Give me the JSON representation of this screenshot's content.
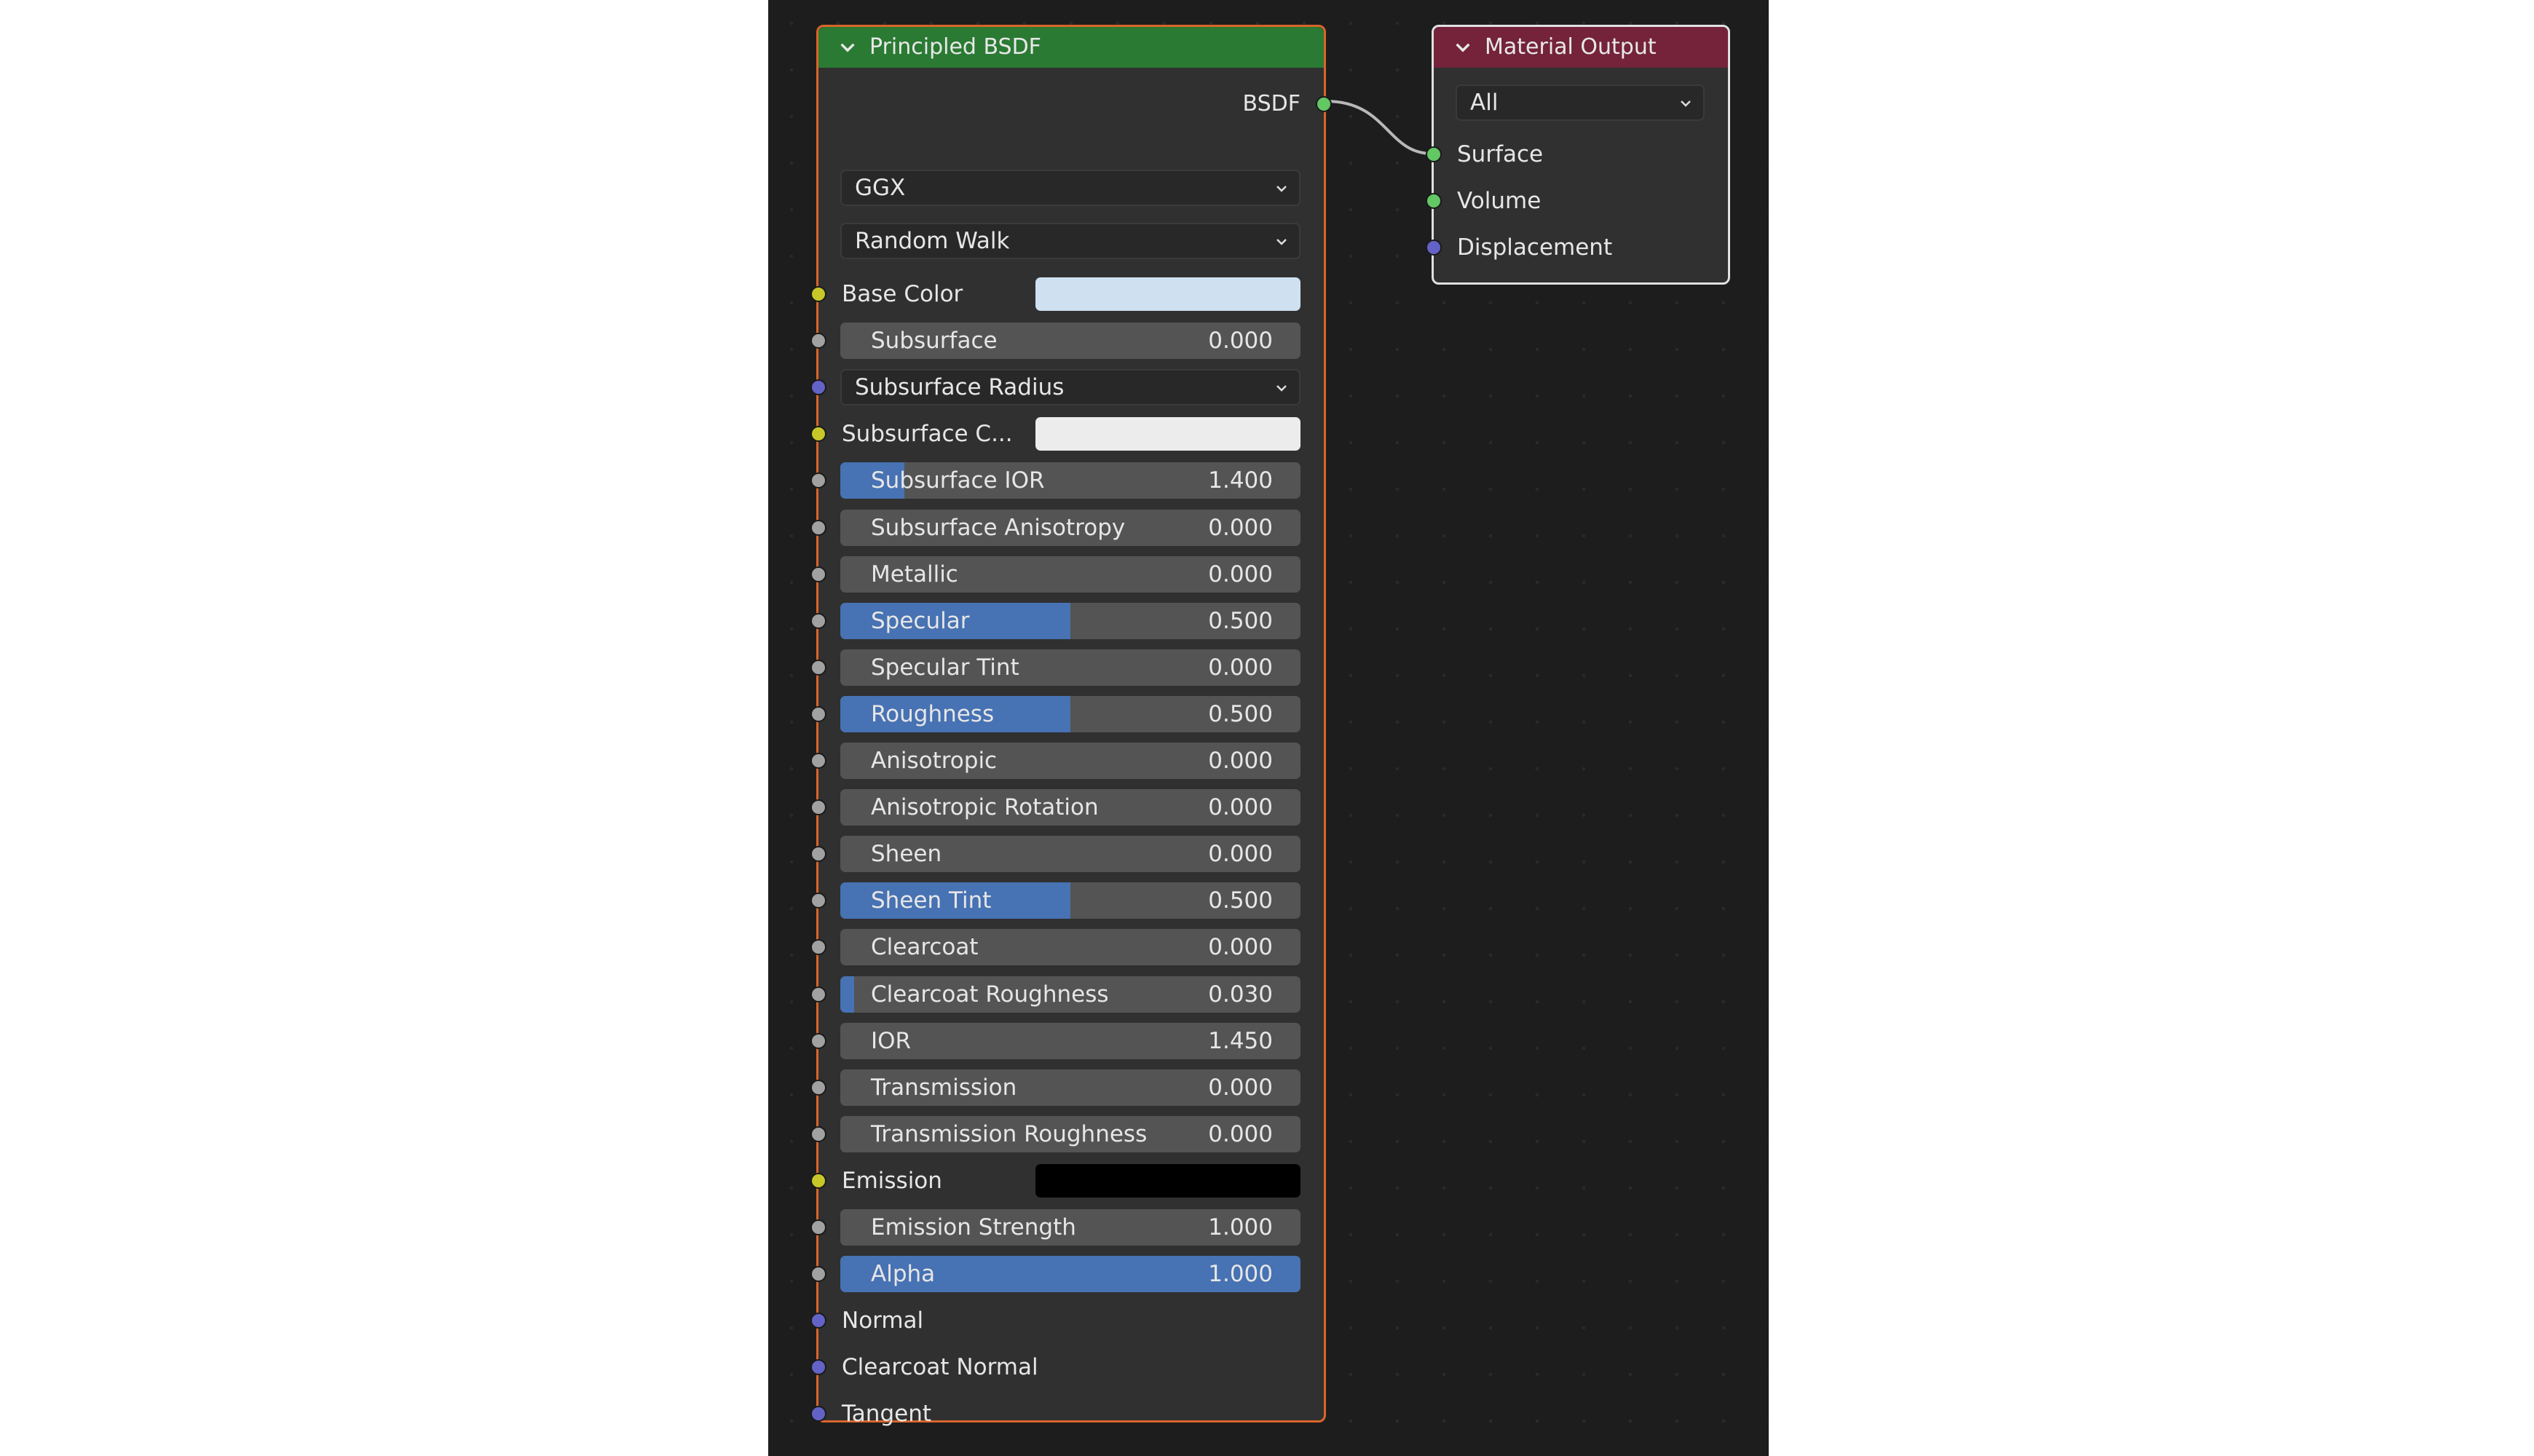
{
  "bsdf_node": {
    "title": "Principled BSDF",
    "header_color": "#2a7a33",
    "border_color": "#d9652a",
    "output_label": "BSDF",
    "distribution": "GGX",
    "subsurface_method": "Random Walk",
    "rows": [
      {
        "kind": "color",
        "label": "Base Color",
        "socket": "yellow",
        "color": "#cfe0f0"
      },
      {
        "kind": "slider",
        "label": "Subsurface",
        "value": "0.000",
        "fraction": 0,
        "socket": "gray"
      },
      {
        "kind": "dropdown",
        "label": "Subsurface Radius",
        "socket": "purple"
      },
      {
        "kind": "color",
        "label": "Subsurface C...",
        "socket": "yellow",
        "color": "#ececec"
      },
      {
        "kind": "slider",
        "label": "Subsurface IOR",
        "value": "1.400",
        "fraction": 0.14,
        "socket": "gray"
      },
      {
        "kind": "slider",
        "label": "Subsurface Anisotropy",
        "value": "0.000",
        "fraction": 0,
        "socket": "gray"
      },
      {
        "kind": "slider",
        "label": "Metallic",
        "value": "0.000",
        "fraction": 0,
        "socket": "gray"
      },
      {
        "kind": "slider",
        "label": "Specular",
        "value": "0.500",
        "fraction": 0.5,
        "socket": "gray"
      },
      {
        "kind": "slider",
        "label": "Specular Tint",
        "value": "0.000",
        "fraction": 0,
        "socket": "gray"
      },
      {
        "kind": "slider",
        "label": "Roughness",
        "value": "0.500",
        "fraction": 0.5,
        "socket": "gray"
      },
      {
        "kind": "slider",
        "label": "Anisotropic",
        "value": "0.000",
        "fraction": 0,
        "socket": "gray"
      },
      {
        "kind": "slider",
        "label": "Anisotropic Rotation",
        "value": "0.000",
        "fraction": 0,
        "socket": "gray"
      },
      {
        "kind": "slider",
        "label": "Sheen",
        "value": "0.000",
        "fraction": 0,
        "socket": "gray"
      },
      {
        "kind": "slider",
        "label": "Sheen Tint",
        "value": "0.500",
        "fraction": 0.5,
        "socket": "gray"
      },
      {
        "kind": "slider",
        "label": "Clearcoat",
        "value": "0.000",
        "fraction": 0,
        "socket": "gray"
      },
      {
        "kind": "slider",
        "label": "Clearcoat Roughness",
        "value": "0.030",
        "fraction": 0.03,
        "socket": "gray"
      },
      {
        "kind": "slider",
        "label": "IOR",
        "value": "1.450",
        "fraction": 0,
        "socket": "gray"
      },
      {
        "kind": "slider",
        "label": "Transmission",
        "value": "0.000",
        "fraction": 0,
        "socket": "gray"
      },
      {
        "kind": "slider",
        "label": "Transmission Roughness",
        "value": "0.000",
        "fraction": 0,
        "socket": "gray"
      },
      {
        "kind": "color",
        "label": "Emission",
        "socket": "yellow",
        "color": "#000000"
      },
      {
        "kind": "slider",
        "label": "Emission Strength",
        "value": "1.000",
        "fraction": 0,
        "socket": "gray"
      },
      {
        "kind": "slider",
        "label": "Alpha",
        "value": "1.000",
        "fraction": 1,
        "socket": "gray"
      },
      {
        "kind": "plain",
        "label": "Normal",
        "socket": "purple"
      },
      {
        "kind": "plain",
        "label": "Clearcoat Normal",
        "socket": "purple"
      },
      {
        "kind": "plain",
        "label": "Tangent",
        "socket": "purple"
      }
    ]
  },
  "output_node": {
    "title": "Material Output",
    "header_color": "#74233b",
    "target": "All",
    "inputs": [
      {
        "label": "Surface",
        "socket": "green"
      },
      {
        "label": "Volume",
        "socket": "green"
      },
      {
        "label": "Displacement",
        "socket": "purple"
      }
    ]
  }
}
